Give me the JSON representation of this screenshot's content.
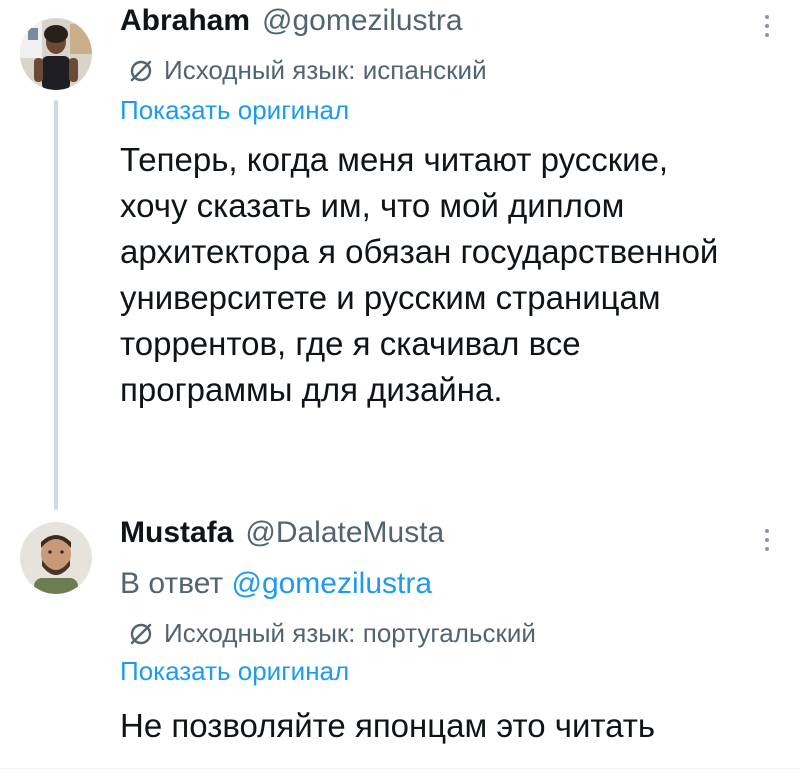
{
  "tweets": [
    {
      "name": "Abraham",
      "handle": "@gomezilustra",
      "source_language": "Исходный язык: испанский",
      "show_original": "Показать оригинал",
      "lines": [
        "Теперь, когда меня читают русские,",
        "хочу сказать им, что мой диплом",
        "архитектора я обязан государственной",
        "университете и русским страницам",
        "торрентов, где я скачивал все",
        "программы для дизайна."
      ]
    },
    {
      "name": "Mustafa",
      "handle": "@DalateMusta",
      "reply_prefix": "В ответ",
      "reply_handle": "@gomezilustra",
      "source_language": "Исходный язык: португальский",
      "show_original": "Показать оригинал",
      "text": "Не позволяйте японцам это читать"
    }
  ],
  "icons": {
    "more": "more-vertical-icon",
    "translate": "translate-icon"
  },
  "colors": {
    "link": "#1d9bf0",
    "secondary_text": "#536471",
    "primary_text": "#0f1419",
    "thread_line": "#cfd9de"
  }
}
